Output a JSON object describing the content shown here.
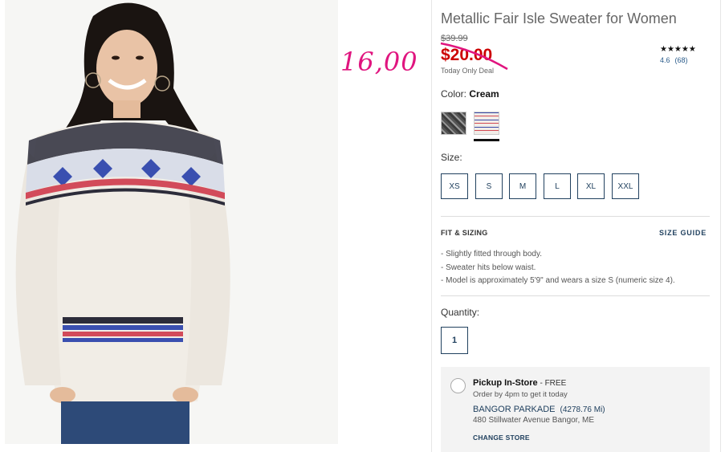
{
  "product": {
    "title": "Metallic Fair Isle Sweater for Women",
    "old_price": "$39.99",
    "new_price": "$20.00",
    "deal_note": "Today Only Deal",
    "annotation": "16,00",
    "rating_stars": "★★★★★",
    "rating_value": "4.6",
    "rating_count": "(68)"
  },
  "color": {
    "label": "Color:",
    "selected": "Cream",
    "swatches": [
      {
        "name": "dark-grey-fair-isle",
        "color": "#555555"
      },
      {
        "name": "cream-fair-isle",
        "color": "#f1ede8"
      }
    ]
  },
  "size": {
    "label": "Size:",
    "options": [
      "XS",
      "S",
      "M",
      "L",
      "XL",
      "XXL"
    ]
  },
  "fit": {
    "title": "FIT & SIZING",
    "guide_link": "SIZE GUIDE",
    "bullets": [
      "-  Slightly fitted through body.",
      "-  Sweater hits below waist.",
      "-  Model is approximately 5'9\" and wears a size S (numeric size 4)."
    ]
  },
  "quantity": {
    "label": "Quantity:",
    "value": "1"
  },
  "pickup": {
    "title": "Pickup In-Store",
    "free": " - FREE",
    "subtitle": "Order by 4pm to get it today",
    "store_name": "BANGOR PARKADE",
    "store_distance": "(4278.76 Mi)",
    "address": "480 Stillwater Avenue Bangor, ME",
    "change_link": "CHANGE STORE"
  },
  "colors": {
    "price_red": "#cc0000",
    "annotation_pink": "#e0157f",
    "navy": "#21415f"
  }
}
